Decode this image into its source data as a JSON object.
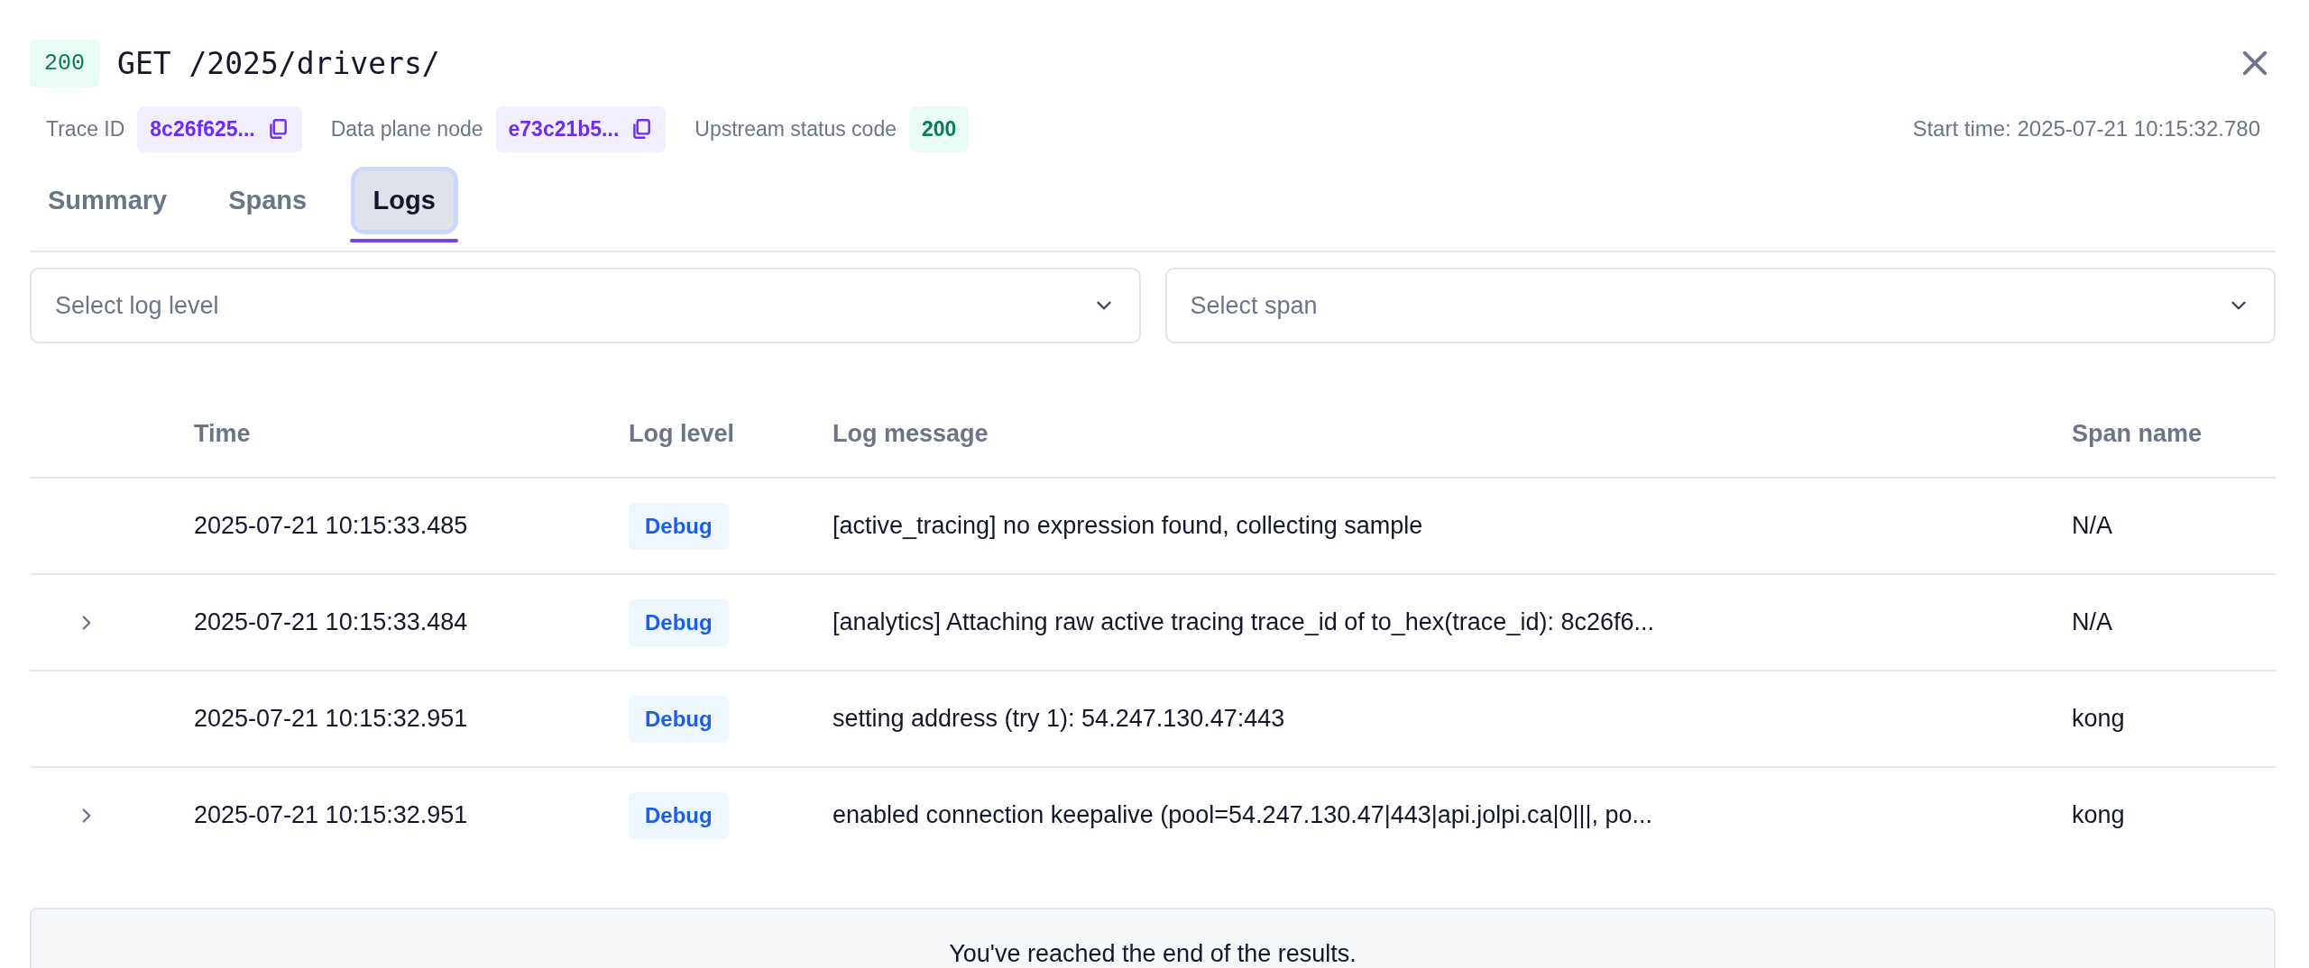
{
  "request": {
    "status": "200",
    "method_path": "GET /2025/drivers/"
  },
  "meta": [
    {
      "label": "Trace ID",
      "value": "8c26f625...",
      "kind": "copy"
    },
    {
      "label": "Data plane node",
      "value": "e73c21b5...",
      "kind": "copy"
    },
    {
      "label": "Upstream status code",
      "value": "200",
      "kind": "status"
    }
  ],
  "start_time": "Start time: 2025-07-21 10:15:32.780",
  "tabs": [
    {
      "label": "Summary",
      "selected": false
    },
    {
      "label": "Spans",
      "selected": false
    },
    {
      "label": "Logs",
      "selected": true
    }
  ],
  "filters": [
    {
      "placeholder": "Select log level"
    },
    {
      "placeholder": "Select span"
    }
  ],
  "table": {
    "columns": [
      "Time",
      "Log level",
      "Log message",
      "Span name"
    ],
    "rows": [
      {
        "expandable": false,
        "time": "2025-07-21 10:15:33.485",
        "level": "Debug",
        "message": "[active_tracing] no expression found, collecting sample",
        "span": "N/A"
      },
      {
        "expandable": true,
        "time": "2025-07-21 10:15:33.484",
        "level": "Debug",
        "message": "[analytics] Attaching raw active tracing trace_id of to_hex(trace_id): 8c26f6...",
        "span": "N/A"
      },
      {
        "expandable": false,
        "time": "2025-07-21 10:15:32.951",
        "level": "Debug",
        "message": "setting address (try 1): 54.247.130.47:443",
        "span": "kong"
      },
      {
        "expandable": true,
        "time": "2025-07-21 10:15:32.951",
        "level": "Debug",
        "message": "enabled connection keepalive (pool=54.247.130.47|443|api.jolpi.ca|0|||, po...",
        "span": "kong"
      }
    ]
  },
  "end_message": "You've reached the end of the results."
}
